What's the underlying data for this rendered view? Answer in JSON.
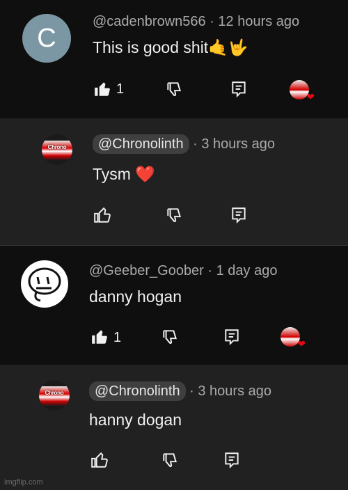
{
  "comments": [
    {
      "avatar_letter": "C",
      "handle": "@cadenbrown566",
      "time": "· 12 hours ago",
      "text": "This is good shit🤙🤟",
      "likes": "1"
    },
    {
      "avatar_text": "Chrono",
      "handle": "@Chronolinth",
      "time": "· 3 hours ago",
      "text": "Tysm ❤️"
    },
    {
      "handle": "@Geeber_Goober",
      "time": "· 1 day ago",
      "text": "danny hogan",
      "likes": "1"
    },
    {
      "avatar_text": "Chrono",
      "handle": "@Chronolinth",
      "time": "· 3 hours ago",
      "text": "hanny dogan"
    }
  ],
  "watermark": "imgflip.com",
  "colors": {
    "background": "#0f0f0f",
    "reply_background": "#212121",
    "accent_heart": "#e50914"
  }
}
